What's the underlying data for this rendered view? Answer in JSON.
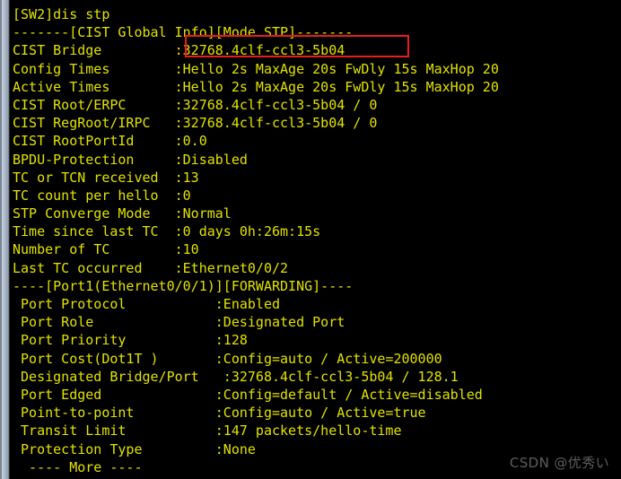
{
  "theme": {
    "background": "#000000",
    "text_color": "#e2e200",
    "annotation_color": "#e81d1d",
    "watermark_color": "#5e5e5e",
    "scrollbar_color": "#aebccd"
  },
  "terminal": {
    "prompt_line": "[SW2]dis stp",
    "lines": [
      "[SW2]dis stp",
      "-------[CIST Global Info][Mode STP]-------",
      "CIST Bridge         :32768.4clf-ccl3-5b04",
      "Config Times        :Hello 2s MaxAge 20s FwDly 15s MaxHop 20",
      "Active Times        :Hello 2s MaxAge 20s FwDly 15s MaxHop 20",
      "CIST Root/ERPC      :32768.4clf-ccl3-5b04 / 0",
      "CIST RegRoot/IRPC   :32768.4clf-ccl3-5b04 / 0",
      "CIST RootPortId     :0.0",
      "BPDU-Protection     :Disabled",
      "TC or TCN received  :13",
      "TC count per hello  :0",
      "STP Converge Mode   :Normal",
      "Time since last TC  :0 days 0h:26m:15s",
      "Number of TC        :10",
      "Last TC occurred    :Ethernet0/0/2",
      "----[Port1(Ethernet0/0/1)][FORWARDING]----",
      " Port Protocol           :Enabled",
      " Port Role               :Designated Port",
      " Port Priority           :128",
      " Port Cost(Dot1T )       :Config=auto / Active=200000",
      " Designated Bridge/Port   :32768.4clf-ccl3-5b04 / 128.1",
      " Port Edged              :Config=default / Active=disabled",
      " Point-to-point          :Config=auto / Active=true",
      " Transit Limit           :147 packets/hello-time",
      " Protection Type         :None",
      "  ---- More ----"
    ],
    "command": "dis stp",
    "device_name": "SW2",
    "more_prompt": "  ---- More ----",
    "fields": {
      "cist_bridge": "32768.4clf-ccl3-5b04",
      "config_times": "Hello 2s MaxAge 20s FwDly 15s MaxHop 20",
      "active_times": "Hello 2s MaxAge 20s FwDly 15s MaxHop 20",
      "cist_root_erpc": "32768.4clf-ccl3-5b04 / 0",
      "cist_regroot_irpc": "32768.4clf-ccl3-5b04 / 0",
      "cist_rootportid": "0.0",
      "bpdu_protection": "Disabled",
      "tc_or_tcn_received": "13",
      "tc_count_per_hello": "0",
      "stp_converge_mode": "Normal",
      "time_since_last_tc": "0 days 0h:26m:15s",
      "number_of_tc": "10",
      "last_tc_occurred": "Ethernet0/0/2",
      "port_protocol": "Enabled",
      "port_role": "Designated Port",
      "port_priority": "128",
      "port_cost": "Config=auto / Active=200000",
      "designated_bridge_port": "32768.4clf-ccl3-5b04 / 128.1",
      "port_edged": "Config=default / Active=disabled",
      "point_to_point": "Config=auto / Active=true",
      "transit_limit": "147 packets/hello-time",
      "protection_type": "None",
      "mode": "STP",
      "port_state": "FORWARDING",
      "port_name": "Port1(Ethernet0/0/1)"
    }
  },
  "annotation": {
    "target_text": ":32768.4clf-ccl3-5b04",
    "shape": "rectangle"
  },
  "watermark": {
    "text": "CSDN @优秀い"
  }
}
